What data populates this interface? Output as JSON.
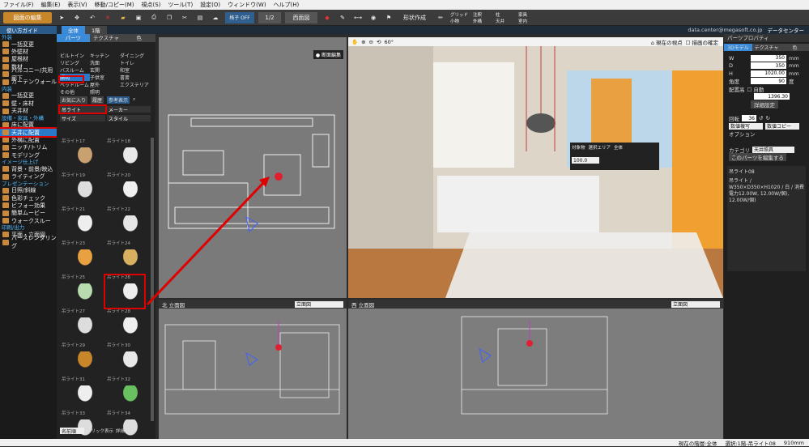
{
  "menu": [
    "ファイル(F)",
    "編集(E)",
    "表示(V)",
    "移動/コピー(M)",
    "視点(S)",
    "ツール(T)",
    "設定(O)",
    "ウィンドウ(W)",
    "ヘルプ(H)"
  ],
  "toolbar": {
    "plan_label": "図面の編集",
    "floor": "1/2",
    "view_select": "西面図",
    "shape_label": "形状作成",
    "checks": [
      "グリッド",
      "注釈",
      "柱",
      "家具",
      "小物",
      "外構",
      "天井",
      "室内"
    ]
  },
  "row2": {
    "guide": "使い方ガイド",
    "tab_all": "全体",
    "tab_floor": "1階",
    "user": "data.center@megasoft.co.jp",
    "server": "データセンター"
  },
  "nav": {
    "sections": [
      {
        "title": "外装",
        "items": [
          "一括変更",
          "外壁材",
          "屋根材",
          "数材",
          "バルコニー/共用廊下",
          "カーテンウォール"
        ]
      },
      {
        "title": "内装",
        "items": [
          "一括変更",
          "壁・床材",
          "天井材"
        ]
      },
      {
        "title": "設備・家具・外構",
        "items": [
          "床に配置",
          "天井に配置",
          "外構に配置",
          "ニッチ/トリム",
          "モデリング"
        ]
      },
      {
        "title": "イメージ仕上げ",
        "items": [
          "背景・前景/映込",
          "ライティング"
        ]
      },
      {
        "title": "プレゼンテーション",
        "items": [
          "日照/斜線",
          "色彩チェック",
          "ビフォー効果",
          "簡単ムービー",
          "ウォークスルー"
        ]
      },
      {
        "title": "印刷/出力",
        "items": [
          "平面・立面図",
          "パースレンダリング"
        ]
      }
    ],
    "selected": "天井に配置"
  },
  "catalog": {
    "tabs": [
      "パーツ",
      "テクスチャ",
      "色"
    ],
    "categories": [
      "ビルトイン",
      "キッチン",
      "ダイニング",
      "リビング",
      "洗面",
      "トイレ",
      "バスルーム",
      "玄関",
      "和室",
      "照明",
      "子供室",
      "書斎",
      "ベッドルーム",
      "屋外",
      "エクステリア",
      "その他",
      "照明"
    ],
    "selected_category": "照明",
    "buttons": [
      "お気に入り",
      "履歴",
      "参考表示"
    ],
    "filter_label": "吊ライト",
    "maker_label": "メーカー",
    "size_label": "サイズ",
    "style_label": "スタイル",
    "items": [
      "吊ライト17",
      "吊ライト18",
      "吊ライト19",
      "吊ライト20",
      "吊ライト21",
      "吊ライト22",
      "吊ライト23",
      "吊ライト24",
      "吊ライト25",
      "吊ライト26",
      "吊ライト27",
      "吊ライト28",
      "吊ライト29",
      "吊ライト30",
      "吊ライト31",
      "吊ライト32",
      "吊ライト33",
      "吊ライト34"
    ],
    "sort": "名前順",
    "footer_opts": [
      "クリック表示",
      "詳細"
    ]
  },
  "views": {
    "plan_label": "断面編集",
    "north_label": "北 立面図",
    "north_select": "立面図",
    "west_label": "西 立面図",
    "west_select": "立面図",
    "viewpoint_label": "現在の視点",
    "save_label": "描画の確定",
    "angle": "60°",
    "popup": {
      "opts": [
        "対象物",
        "選択エリア",
        "全体"
      ],
      "value": "100.0"
    }
  },
  "props": {
    "title": "パーツプロパティ",
    "tabs": [
      "3Dモデル",
      "テクスチャ",
      "色"
    ],
    "fields": [
      {
        "label": "W",
        "value": "350",
        "unit": "mm"
      },
      {
        "label": "D",
        "value": "350",
        "unit": "mm"
      },
      {
        "label": "H",
        "value": "1020.00",
        "unit": "mm"
      },
      {
        "label": "角度",
        "value": "90",
        "unit": "度"
      }
    ],
    "placement_label": "配置高",
    "auto_label": "自動",
    "placement_value": "1396.30",
    "detail_button": "詳細設定",
    "rotate_label": "回転",
    "rotate_value": "36",
    "copy_mode1": "数値複写",
    "copy_mode2": "数値コピー",
    "option_label": "オプション",
    "category_label": "カテゴリ",
    "category_value": "天井照具",
    "edit_button": "このパーツを編集する",
    "name": "吊ライト08",
    "desc": "吊ライト / W350×D350×H1020 / 白 / 消費電力12.00W, 12.00W/個), 12.00W/個)"
  },
  "status": [
    "現在の階層:全体",
    "選択:1階-吊ライト08",
    "910mm"
  ]
}
